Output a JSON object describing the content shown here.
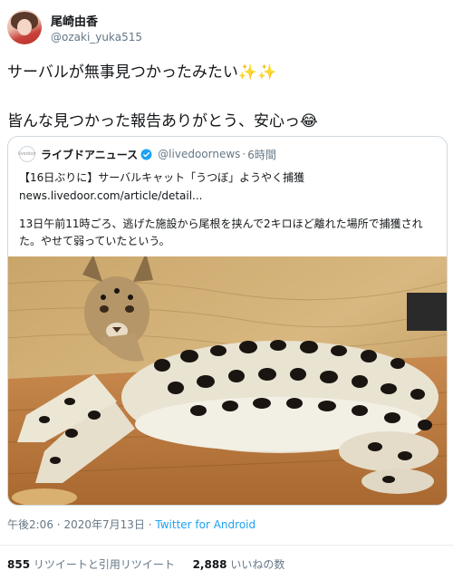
{
  "author": {
    "display_name": "尾崎由香",
    "handle": "@ozaki_yuka515"
  },
  "tweet": {
    "line1": "サーバルが無事見つかったみたい✨✨",
    "line2": "皆んな見つかった報告ありがとう、安心っ😂"
  },
  "quoted": {
    "source_name": "ライブドアニュース",
    "source_logo_text": "livedoor",
    "source_handle": "@livedoornews",
    "time_ago": "6時間",
    "separator": "·",
    "title": "【16日ぶりに】サーバルキャット「うつぼ」ようやく捕獲",
    "url": "news.livedoor.com/article/detail...",
    "description": "13日午前11時ごろ、逃げた施設から尾根を挟んで2キロほど離れた場所で捕獲された。やせて弱っていたという。"
  },
  "meta": {
    "time": "午後2:06",
    "separator": "·",
    "date": "2020年7月13日",
    "via": "Twitter for Android"
  },
  "stats": {
    "retweets": "855",
    "retweets_label": "リツイートと引用リツイート",
    "likes": "2,888",
    "likes_label": "いいねの数"
  },
  "colors": {
    "link": "#1da1f2",
    "verified": "#1da1f2",
    "muted": "#657786"
  }
}
